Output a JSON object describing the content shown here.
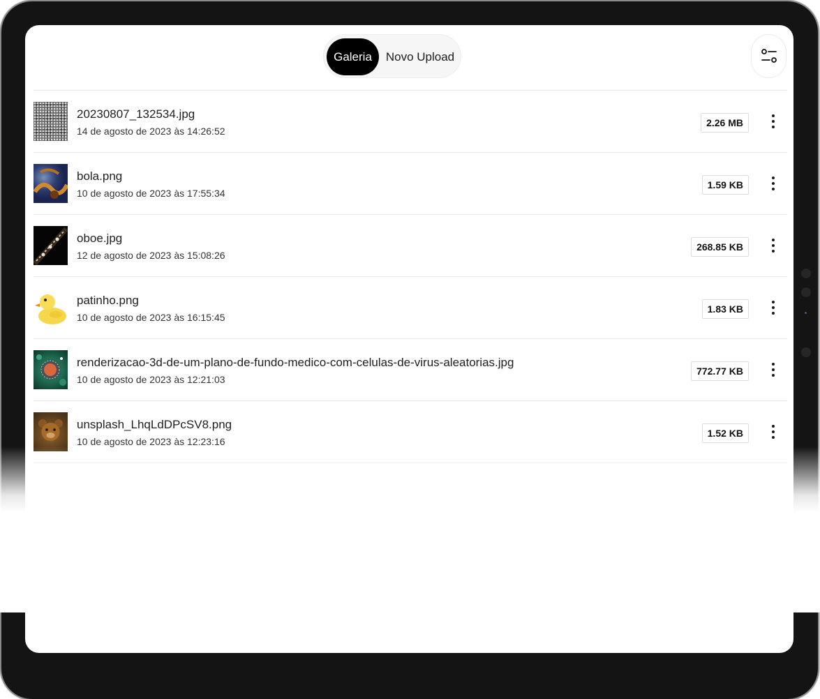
{
  "tabs": {
    "gallery_label": "Galeria",
    "upload_label": "Novo Upload"
  },
  "toolbar": {
    "filter_icon": "sliders-icon"
  },
  "files": [
    {
      "name": "20230807_132534.jpg",
      "date": "14 de agosto de 2023 às 14:26:52",
      "size": "2.26 MB",
      "thumbnail": "gravel-texture"
    },
    {
      "name": "bola.png",
      "date": "10 de agosto de 2023 às 17:55:34",
      "size": "1.59 KB",
      "thumbnail": "ball-closeup"
    },
    {
      "name": "oboe.jpg",
      "date": "12 de agosto de 2023 às 15:08:26",
      "size": "268.85 KB",
      "thumbnail": "oboe-instrument"
    },
    {
      "name": "patinho.png",
      "date": "10 de agosto de 2023 às 16:15:45",
      "size": "1.83 KB",
      "thumbnail": "rubber-duck"
    },
    {
      "name": "renderizacao-3d-de-um-plano-de-fundo-medico-com-celulas-de-virus-aleatorias.jpg",
      "date": "10 de agosto de 2023 às 12:21:03",
      "size": "772.77 KB",
      "thumbnail": "virus-cells-render"
    },
    {
      "name": "unsplash_LhqLdDPcSV8.png",
      "date": "10 de agosto de 2023 às 12:23:16",
      "size": "1.52 KB",
      "thumbnail": "teddy-bear"
    }
  ],
  "colors": {
    "active_tab_bg": "#000000",
    "active_tab_text": "#ffffff",
    "device_frame": "#141414"
  }
}
